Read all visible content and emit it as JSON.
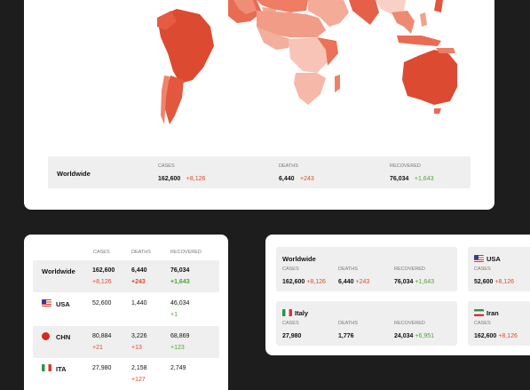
{
  "worldwide_bar": {
    "title": "Worldwide",
    "cases_label": "CASES",
    "cases": "162,600",
    "cases_delta": "+8,126",
    "deaths_label": "DEATHS",
    "deaths": "6,440",
    "deaths_delta": "+243",
    "recovered_label": "RECOVERED",
    "recovered": "76,034",
    "recovered_delta": "+1,643"
  },
  "table": {
    "headers": {
      "cases": "CASES",
      "deaths": "DEATHS",
      "recovered": "RECOVERED"
    },
    "rows": [
      {
        "name": "Worldwide",
        "flag": "globe",
        "cases": "162,600",
        "cases_delta": "+8,126",
        "deaths": "6,440",
        "deaths_delta": "+243",
        "recovered": "76,034",
        "recovered_delta": "+1,643"
      },
      {
        "name": "USA",
        "flag": "us-flag-icon",
        "cases": "52,600",
        "cases_delta": "",
        "deaths": "1,440",
        "deaths_delta": "",
        "recovered": "46,034",
        "recovered_delta": "+1"
      },
      {
        "name": "CHN",
        "flag": "cn-flag-icon",
        "cases": "80,884",
        "cases_delta": "+21",
        "deaths": "3,226",
        "deaths_delta": "+13",
        "recovered": "68,869",
        "recovered_delta": "+123"
      },
      {
        "name": "ITA",
        "flag": "it-flag-icon",
        "cases": "27,980",
        "cases_delta": "",
        "deaths": "2,158",
        "deaths_delta": "+127",
        "recovered": "2,749",
        "recovered_delta": ""
      }
    ]
  },
  "cards": {
    "worldwide": {
      "title": "Worldwide",
      "cases_label": "CASES",
      "cases": "162,600",
      "cases_delta": "+8,126",
      "deaths_label": "DEATHS",
      "deaths": "6,440",
      "deaths_delta": "+243",
      "recovered_label": "RECOVERED",
      "recovered": "76,034",
      "recovered_delta": "+1,643"
    },
    "usa": {
      "title": "USA",
      "cases_label": "CASES",
      "cases": "52,600",
      "cases_delta": "+8,126"
    },
    "italy": {
      "title": "Italy",
      "cases_label": "CASES",
      "cases": "27,980",
      "deaths_label": "DEATHS",
      "deaths": "1,776",
      "recovered_label": "RECOVERED",
      "recovered": "24,034",
      "recovered_delta": "+6,951"
    },
    "iran": {
      "title": "Iran",
      "cases_label": "CASES",
      "cases": "162,600",
      "cases_delta": "+8,126"
    }
  },
  "colors": {
    "accent_red": "#e0492a",
    "accent_green": "#4aa72f",
    "background": "#1d1d1d",
    "map_dark": "#dc4a32",
    "map_light": "#f6b5a6"
  }
}
